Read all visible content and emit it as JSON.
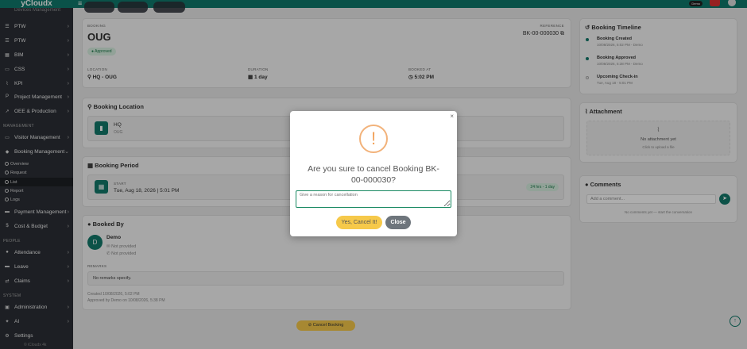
{
  "app": {
    "brand": "yCloudx",
    "clipped_item": "Devices Management",
    "user": "Demo",
    "footer": "© iCloudx 4k"
  },
  "sidebar": {
    "items_top": [
      {
        "label": "PTW",
        "icon": "list-icon"
      },
      {
        "label": "PTW",
        "icon": "list-icon"
      },
      {
        "label": "BIM",
        "icon": "grid-icon"
      },
      {
        "label": "CSS",
        "icon": "monitor-icon"
      },
      {
        "label": "KPI",
        "icon": "chart-icon"
      },
      {
        "label": "Project Management",
        "icon": "project-icon"
      },
      {
        "label": "OEE & Production",
        "icon": "trend-icon"
      }
    ],
    "section_management": "MANAGEMENT",
    "visitor": "Visitor Management",
    "booking": "Booking Management",
    "booking_sub": [
      "Overview",
      "Request",
      "List",
      "Report",
      "Logs"
    ],
    "payment": "Payment Management",
    "cost": "Cost & Budget",
    "section_people": "PEOPLE",
    "attendance": "Attendance",
    "leave": "Leave",
    "claims": "Claims",
    "section_system": "SYSTEM",
    "administration": "Administration",
    "ai": "AI",
    "settings": "Settings"
  },
  "booking": {
    "booking_label": "BOOKING",
    "name": "OUG",
    "status": "Approved",
    "reference_label": "REFERENCE",
    "reference": "BK-00-000030",
    "location_label": "LOCATION",
    "location": "HQ - OUG",
    "duration_label": "DURATION",
    "duration": "1 day",
    "booked_at_label": "BOOKED AT",
    "booked_at": "5:02 PM"
  },
  "location_card": {
    "title": "Booking Location",
    "site": "HQ",
    "sub": "OUG"
  },
  "period_card": {
    "title": "Booking Period",
    "start_label": "START",
    "start": "Tue, Aug 18, 2026 | 5:01 PM",
    "badge": "24 hrs - 1 day"
  },
  "booked_by": {
    "title": "Booked By",
    "avatar": "D",
    "name": "Demo",
    "email": "Not provided",
    "phone": "Not provided",
    "remarks_label": "REMARKS",
    "remarks": "No remarks specify.",
    "created": "Created 10/08/2026, 5:02 PM",
    "approved": "Approved by Demo on 10/08/2026, 5:38 PM"
  },
  "cancel_button": "Cancel Booking",
  "timeline": {
    "title": "Booking Timeline",
    "events": [
      {
        "title": "Booking Created",
        "meta": "10/08/2026, 5:02 PM - Demo"
      },
      {
        "title": "Booking Approved",
        "meta": "10/08/2026, 5:38 PM - Demo"
      },
      {
        "title": "Upcoming Check-in",
        "meta": "Tue, Aug 18 - 5:01 PM"
      }
    ]
  },
  "attachment": {
    "title": "Attachment",
    "empty": "No attachment yet",
    "hint": "Click to upload a file"
  },
  "comments": {
    "title": "Comments",
    "placeholder": "Add a comment...",
    "empty": "No comments yet — start the conversation"
  },
  "modal": {
    "title": "Are you sure to cancel Booking BK-00-000030?",
    "reason_placeholder": "Give a reason for cancellation",
    "confirm": "Yes, Cancel It!",
    "close": "Close"
  },
  "colors": {
    "brand": "#0f7a6c",
    "sidebar": "#2b2f36",
    "warning": "#f2a25b",
    "confirm": "#f6c94a",
    "close": "#6e757c"
  }
}
